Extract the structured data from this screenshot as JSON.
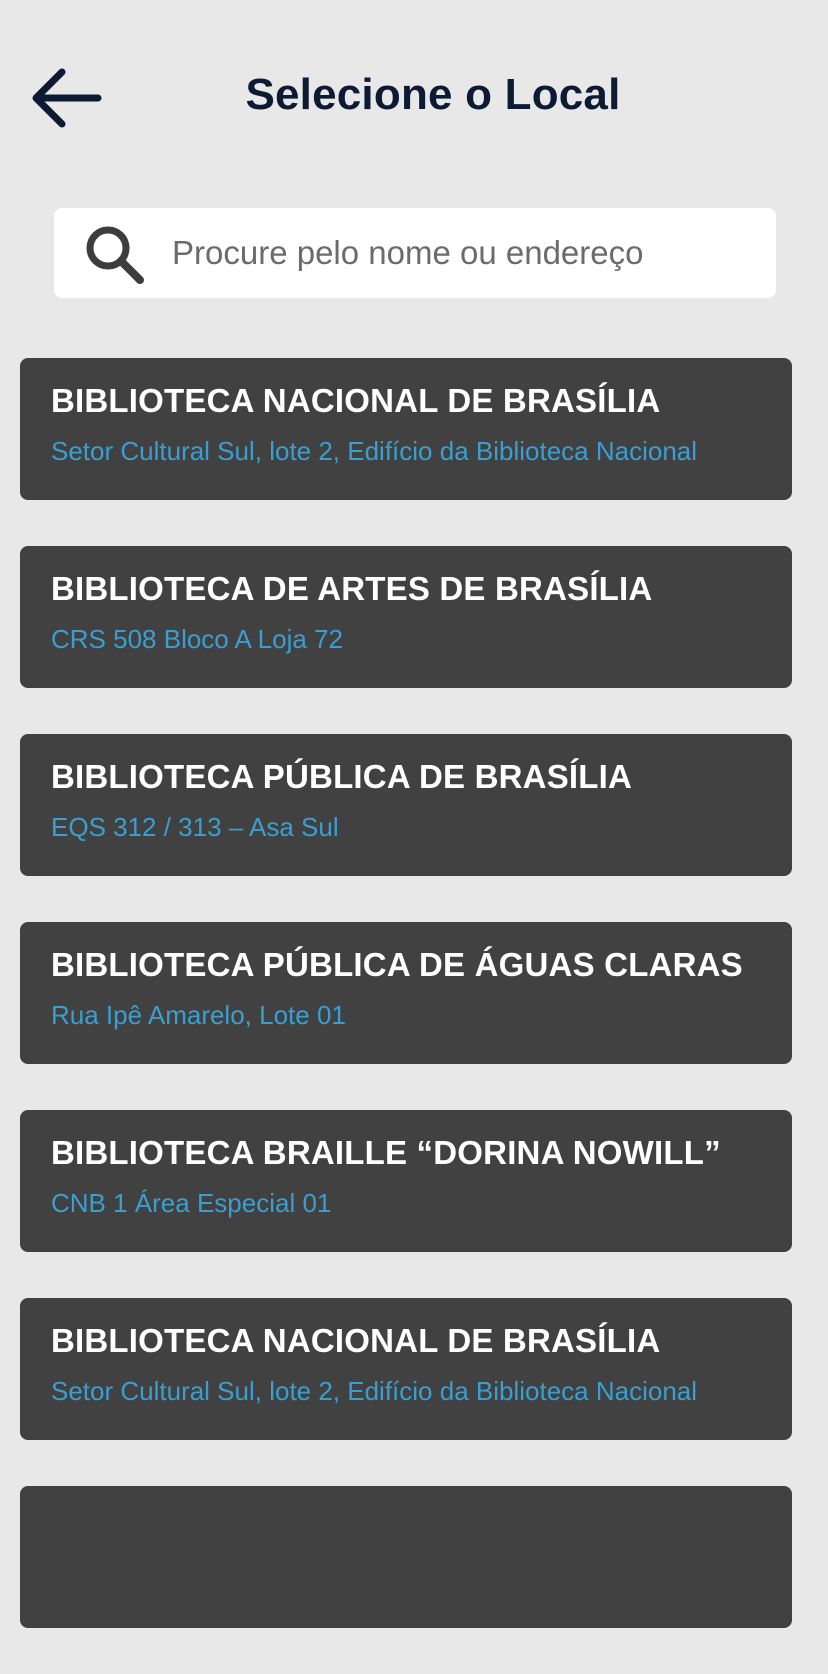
{
  "colors": {
    "background": "#e8e8e8",
    "title": "#0c1a33",
    "card": "#414141",
    "card_title": "#ffffff",
    "card_address": "#3a9fd0"
  },
  "header": {
    "back_icon": "arrow-left-icon",
    "title": "Selecione o Local"
  },
  "search": {
    "icon": "search-icon",
    "placeholder": "Procure pelo nome ou endereço",
    "value": ""
  },
  "places": [
    {
      "name": "BIBLIOTECA NACIONAL DE BRASÍLIA",
      "address": "Setor Cultural Sul, lote 2, Edifício da Biblioteca Nacional"
    },
    {
      "name": "BIBLIOTECA DE ARTES DE BRASÍLIA",
      "address": "CRS 508 Bloco A Loja 72"
    },
    {
      "name": "BIBLIOTECA PÚBLICA DE BRASÍLIA",
      "address": "EQS 312 / 313 – Asa Sul"
    },
    {
      "name": "BIBLIOTECA PÚBLICA DE ÁGUAS CLARAS",
      "address": "Rua Ipê Amarelo, Lote 01"
    },
    {
      "name": "BIBLIOTECA BRAILLE “DORINA NOWILL”",
      "address": "CNB 1 Área Especial 01"
    },
    {
      "name": "BIBLIOTECA NACIONAL DE BRASÍLIA",
      "address": "Setor Cultural Sul, lote 2, Edifício da Biblioteca Nacional"
    },
    {
      "name": "",
      "address": ""
    }
  ]
}
